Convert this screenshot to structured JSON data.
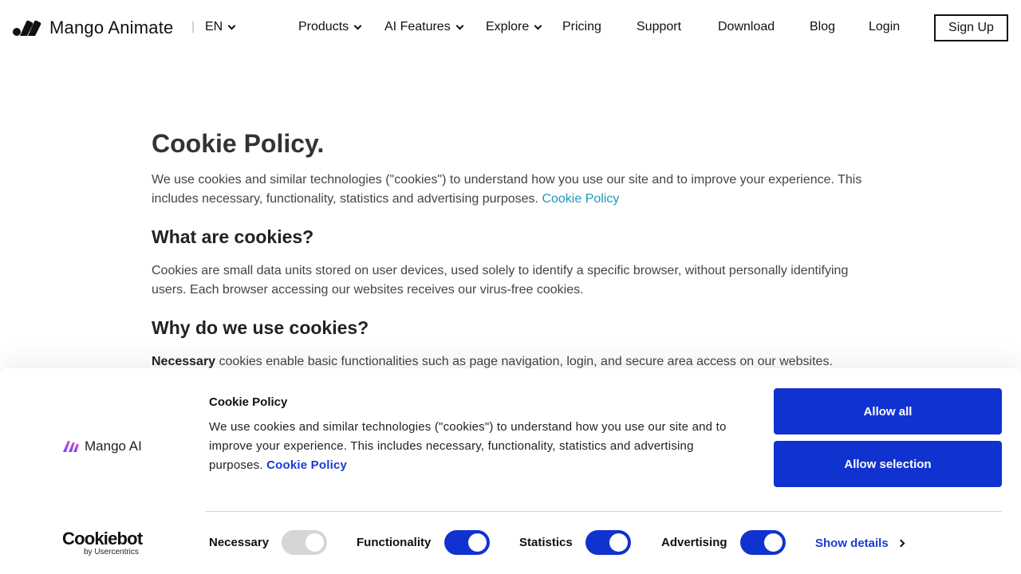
{
  "header": {
    "brand": "Mango Animate",
    "lang": "EN",
    "nav": [
      {
        "label": "Products",
        "dropdown": true
      },
      {
        "label": "AI Features",
        "dropdown": true
      },
      {
        "label": "Explore",
        "dropdown": true
      },
      {
        "label": "Pricing",
        "dropdown": false
      },
      {
        "label": "Support",
        "dropdown": false
      },
      {
        "label": "Download",
        "dropdown": false
      },
      {
        "label": "Blog",
        "dropdown": false
      },
      {
        "label": "Login",
        "dropdown": false
      }
    ],
    "signup": "Sign Up"
  },
  "content": {
    "title": "Cookie Policy.",
    "intro": "We use cookies and similar technologies (\"cookies\") to understand how you use our site and to improve your experience. This includes necessary, functionality, statistics and advertising purposes.",
    "intro_link": "Cookie Policy",
    "h2_what": "What are cookies?",
    "what_text": "Cookies are small data units stored on user devices, used solely to identify a specific browser, without personally identifying users. Each browser accessing our websites receives our virus-free cookies.",
    "h2_why": "Why do we use cookies?",
    "necessary_label": "Necessary",
    "necessary_text": " cookies enable basic functionalities such as page navigation, login, and secure area access on our websites."
  },
  "banner": {
    "brand": "Mango AI",
    "title": "Cookie Policy",
    "text": "We use cookies and similar technologies (\"cookies\") to understand how you use our site and to improve your experience. This includes necessary, functionality, statistics and advertising purposes.",
    "link": "Cookie Policy",
    "allow_all": "Allow all",
    "allow_selection": "Allow selection",
    "cookiebot": "Cookiebot",
    "cookiebot_sub": "by Usercentrics",
    "toggles": [
      {
        "label": "Necessary",
        "on": true,
        "disabled": true
      },
      {
        "label": "Functionality",
        "on": true,
        "disabled": false
      },
      {
        "label": "Statistics",
        "on": true,
        "disabled": false
      },
      {
        "label": "Advertising",
        "on": true,
        "disabled": false
      }
    ],
    "show_details": "Show details"
  },
  "colors": {
    "primary": "#1032cf",
    "link": "#1a9bb8",
    "banner_link": "#1b3bd1"
  }
}
